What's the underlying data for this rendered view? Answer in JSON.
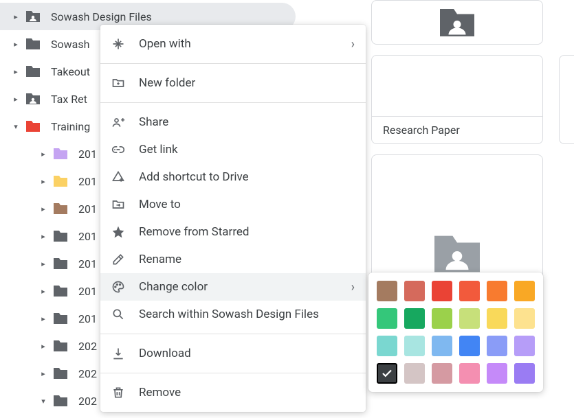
{
  "tree": {
    "items": [
      {
        "arrow": "▸",
        "label": "Sowash Design Files",
        "icon": "shared",
        "color": "#5f6368",
        "selected": true,
        "depth": 0
      },
      {
        "arrow": "▸",
        "label": "Sowash",
        "icon": "folder",
        "color": "#5f6368",
        "depth": 0
      },
      {
        "arrow": "▸",
        "label": "Takeout",
        "icon": "folder",
        "color": "#5f6368",
        "depth": 0
      },
      {
        "arrow": "▸",
        "label": "Tax Ret",
        "icon": "shared",
        "color": "#5f6368",
        "depth": 0
      },
      {
        "arrow": "▾",
        "label": "Training",
        "icon": "folder",
        "color": "#ea4335",
        "depth": 0
      },
      {
        "arrow": "▸",
        "label": "201",
        "icon": "folder",
        "color": "#c5a4f2",
        "depth": 1
      },
      {
        "arrow": "▸",
        "label": "201",
        "icon": "folder",
        "color": "#fbd164",
        "depth": 1
      },
      {
        "arrow": "▸",
        "label": "201",
        "icon": "folder",
        "color": "#a47b60",
        "depth": 1
      },
      {
        "arrow": "▸",
        "label": "201",
        "icon": "folder",
        "color": "#5f6368",
        "depth": 1
      },
      {
        "arrow": "▸",
        "label": "201",
        "icon": "folder",
        "color": "#5f6368",
        "depth": 1
      },
      {
        "arrow": "▸",
        "label": "201",
        "icon": "folder",
        "color": "#5f6368",
        "depth": 1
      },
      {
        "arrow": "▸",
        "label": "201",
        "icon": "folder",
        "color": "#5f6368",
        "depth": 1
      },
      {
        "arrow": "▸",
        "label": "202",
        "icon": "folder",
        "color": "#5f6368",
        "depth": 1
      },
      {
        "arrow": "▸",
        "label": "202",
        "icon": "folder",
        "color": "#5f6368",
        "depth": 1
      },
      {
        "arrow": "▾",
        "label": "202",
        "icon": "folder",
        "color": "#5f6368",
        "depth": 1
      }
    ]
  },
  "menu": {
    "open_with": "Open with",
    "new_folder": "New folder",
    "share": "Share",
    "get_link": "Get link",
    "add_shortcut": "Add shortcut to Drive",
    "move_to": "Move to",
    "remove_star": "Remove from Starred",
    "rename": "Rename",
    "change_color": "Change color",
    "search_within": "Search within Sowash Design Files",
    "download": "Download",
    "remove": "Remove"
  },
  "cards": {
    "research_paper": "Research Paper"
  },
  "picker": {
    "colors": [
      "#a47b60",
      "#d56a5c",
      "#ea4335",
      "#f25a3c",
      "#f87b2f",
      "#f9a825",
      "#34c77a",
      "#17a85f",
      "#9bd14b",
      "#c7e07a",
      "#f9d95a",
      "#fde28f",
      "#7ad7d0",
      "#a8e5e1",
      "#7fb8f0",
      "#4285f4",
      "#8a9cf7",
      "#b69df8",
      "#3c4043",
      "#d4c5c5",
      "#d59aa2",
      "#f48fb1",
      "#c58af9",
      "#9a7cf3"
    ],
    "checked_index": 18
  }
}
